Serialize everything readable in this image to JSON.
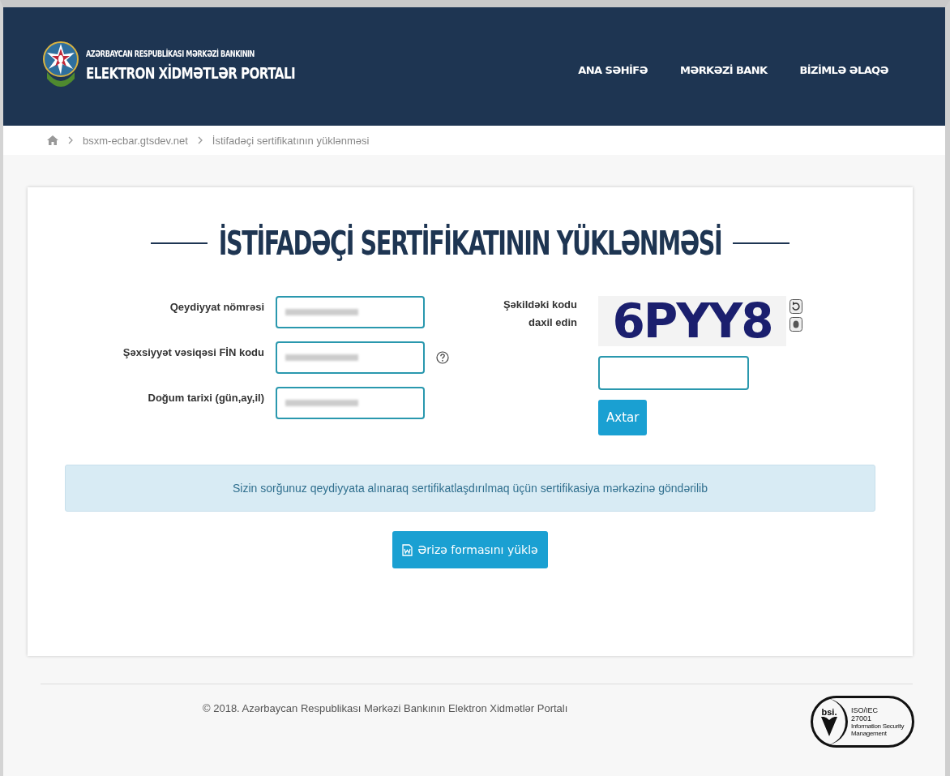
{
  "header": {
    "title_top": "AZƏRBAYCAN RESPUBLİKASI MƏRKƏZİ BANKININ",
    "title_main": "ELEKTRON XİDMƏTLƏR PORTALI",
    "nav": [
      {
        "label": "ANA SƏHİFƏ"
      },
      {
        "label": "MƏRKƏZİ BANK"
      },
      {
        "label": "BİZİMLƏ ƏLAQƏ"
      }
    ]
  },
  "breadcrumb": [
    {
      "label": "bsxm-ecbar.gtsdev.net"
    },
    {
      "label": "İstifadəçi sertifikatının yüklənməsi"
    }
  ],
  "form": {
    "title": "İSTİFADƏÇİ SERTİFİKATININ YÜKLƏNMƏSİ",
    "fields": [
      {
        "label": "Qeydiyyat nömrəsi",
        "help": false
      },
      {
        "label": "Şəxsiyyət vəsiqəsi FİN kodu",
        "help": true
      },
      {
        "label": "Doğum tarixi (gün,ay,il)",
        "help": false
      }
    ],
    "captcha": {
      "label": "Şəkildəki kodu daxil edin",
      "code": "6PYY8"
    },
    "search_button": "Axtar",
    "message": "Sizin sorğunuz qeydiyyata alınaraq sertifikatlaşdırılmaq üçün sertifikasiya mərkəzinə göndərilib",
    "download_button": "Ərizə formasını yüklə"
  },
  "footer": {
    "copyright": "© 2018. Azərbaycan Respublikası Mərkəzi Bankının Elektron Xidmətlər Portalı",
    "badge": {
      "brand": "bsi.",
      "lines": [
        "ISO/IEC",
        "27001",
        "Information Security",
        "Management"
      ]
    }
  }
}
